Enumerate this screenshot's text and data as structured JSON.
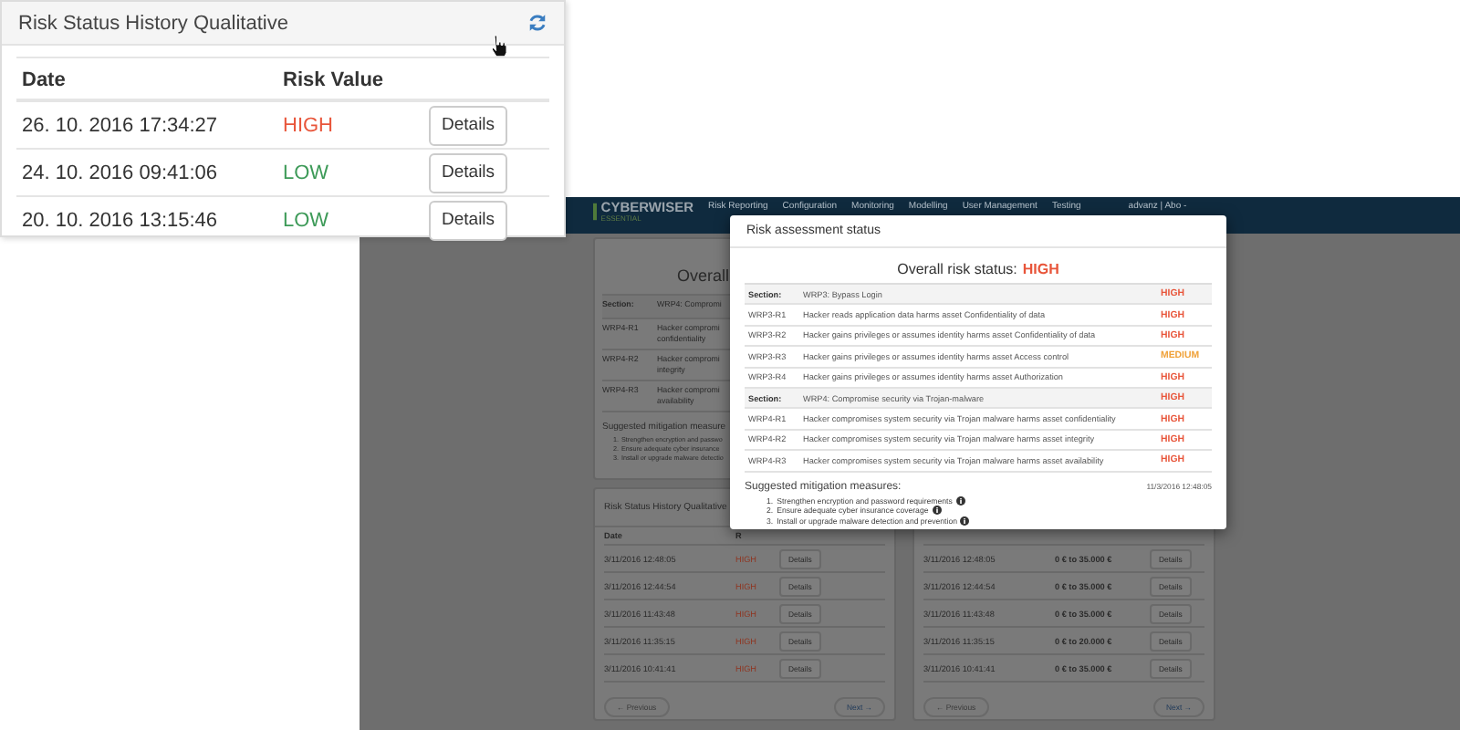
{
  "app": {
    "logo": {
      "name": "CYBERWISER",
      "edition": "ESSENTIAL"
    },
    "nav": [
      "Risk Reporting",
      "Configuration",
      "Monitoring",
      "Modelling",
      "User Management",
      "Testing"
    ],
    "user_menu": "advanz | Abo -",
    "overall_panel": {
      "heading": "Overall",
      "rows": [
        {
          "kind": "section",
          "label": "Section:",
          "lines": [
            "WRP4: Compromi"
          ]
        },
        {
          "kind": "item",
          "label": "WRP4-R1",
          "lines": [
            "Hacker compromi",
            "confidentiality"
          ]
        },
        {
          "kind": "item",
          "label": "WRP4-R2",
          "lines": [
            "Hacker compromi",
            "integrity"
          ]
        },
        {
          "kind": "item",
          "label": "WRP4-R3",
          "lines": [
            "Hacker compromi",
            "availability"
          ]
        }
      ],
      "mitigation_title": "Suggested mitigation measure",
      "mitigations": [
        {
          "number": "1.",
          "text": "Strengthen encryption and passwo"
        },
        {
          "number": "2.",
          "text": "Ensure adequate cyber insurance"
        },
        {
          "number": "3.",
          "text": "Install or upgrade malware detectio"
        }
      ]
    },
    "qualitative_panel": {
      "title": "Risk Status History Qualitative",
      "columns": [
        "Date",
        "R"
      ],
      "rows": [
        {
          "date": "3/11/2016 12:48:05",
          "risk": "HIGH",
          "color": "#8f3520",
          "action": "Details"
        },
        {
          "date": "3/11/2016 12:44:54",
          "risk": "HIGH",
          "color": "#8f3520",
          "action": "Details"
        },
        {
          "date": "3/11/2016 11:43:48",
          "risk": "HIGH",
          "color": "#8f3520",
          "action": "Details"
        },
        {
          "date": "3/11/2016 11:35:15",
          "risk": "HIGH",
          "color": "#8f3520",
          "action": "Details"
        },
        {
          "date": "3/11/2016 10:41:41",
          "risk": "HIGH",
          "color": "#8f3520",
          "action": "Details"
        }
      ],
      "previous": "← Previous",
      "next": "Next →"
    },
    "quantitative_panel": {
      "rows": [
        {
          "date": "3/11/2016 12:48:05",
          "amount": "0 € to 35.000 €",
          "action": "Details"
        },
        {
          "date": "3/11/2016 12:44:54",
          "amount": "0 € to 35.000 €",
          "action": "Details"
        },
        {
          "date": "3/11/2016 11:43:48",
          "amount": "0 € to 35.000 €",
          "action": "Details"
        },
        {
          "date": "3/11/2016 11:35:15",
          "amount": "0 € to 20.000 €",
          "action": "Details"
        },
        {
          "date": "3/11/2016 10:41:41",
          "amount": "0 € to 35.000 €",
          "action": "Details"
        }
      ],
      "previous": "← Previous",
      "next": "Next →"
    },
    "modal": {
      "title": "Risk assessment status",
      "overall_label": "Overall risk status:",
      "overall_value": "HIGH",
      "rows": [
        {
          "kind": "section",
          "label": "Section:",
          "text": "WRP3: Bypass Login",
          "value": "HIGH",
          "color": "#e8553a"
        },
        {
          "kind": "item",
          "label": "WRP3-R1",
          "text": "Hacker reads application data harms asset Confidentiality of data",
          "value": "HIGH",
          "color": "#e8553a"
        },
        {
          "kind": "item",
          "label": "WRP3-R2",
          "text": "Hacker gains privileges or assumes identity harms asset Confidentiality of data",
          "value": "HIGH",
          "color": "#e8553a"
        },
        {
          "kind": "item",
          "label": "WRP3-R3",
          "text": "Hacker gains privileges or assumes identity harms asset Access control",
          "value": "MEDIUM",
          "color": "#f0a23a"
        },
        {
          "kind": "item",
          "label": "WRP3-R4",
          "text": "Hacker gains privileges or assumes identity harms asset Authorization",
          "value": "HIGH",
          "color": "#e8553a"
        },
        {
          "kind": "section",
          "label": "Section:",
          "text": "WRP4: Compromise security via Trojan-malware",
          "value": "HIGH",
          "color": "#e8553a"
        },
        {
          "kind": "item",
          "label": "WRP4-R1",
          "text": "Hacker compromises system security via Trojan malware harms asset confidentiality",
          "value": "HIGH",
          "color": "#e8553a"
        },
        {
          "kind": "item",
          "label": "WRP4-R2",
          "text": "Hacker compromises system security via Trojan malware harms asset integrity",
          "value": "HIGH",
          "color": "#e8553a"
        },
        {
          "kind": "item",
          "label": "WRP4-R3",
          "text": "Hacker compromises system security via Trojan malware harms asset availability",
          "value": "HIGH",
          "color": "#e8553a"
        }
      ],
      "mitigation_title": "Suggested mitigation measures:",
      "date": "11/3/2016 12:48:05",
      "mitigations": [
        {
          "number": "1.",
          "text": "Strengthen encryption and password requirements"
        },
        {
          "number": "2.",
          "text": "Ensure adequate cyber insurance coverage"
        },
        {
          "number": "3.",
          "text": "Install or upgrade malware detection and prevention"
        }
      ]
    }
  },
  "history_card": {
    "title": "Risk Status History Qualitative",
    "columns": [
      "Date",
      "Risk Value"
    ],
    "rows": [
      {
        "date": "26. 10. 2016 17:34:27",
        "risk": "HIGH",
        "color": "#e8553a",
        "action": "Details"
      },
      {
        "date": "24. 10. 2016 09:41:06",
        "risk": "LOW",
        "color": "#3d9a58",
        "action": "Details"
      },
      {
        "date": "20. 10. 2016 13:15:46",
        "risk": "LOW",
        "color": "#3d9a58",
        "action": "Details"
      }
    ]
  }
}
